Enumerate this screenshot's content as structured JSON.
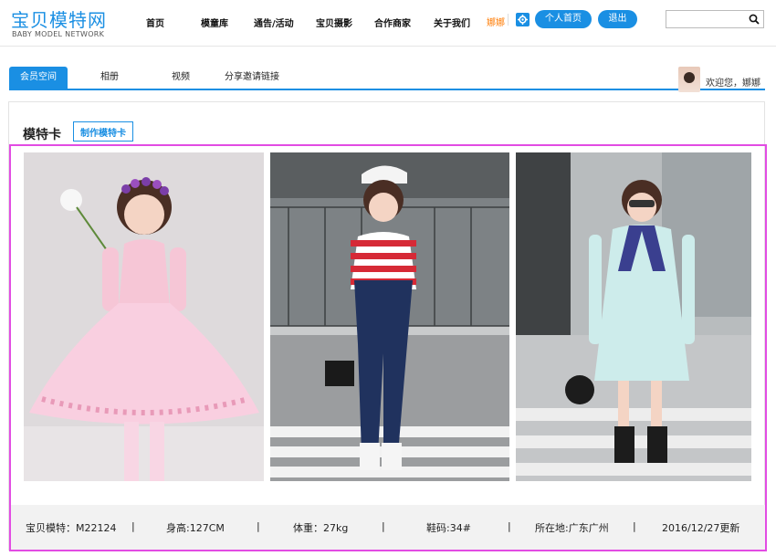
{
  "header": {
    "logo_cn": "宝贝模特网",
    "logo_en": "BABY MODEL NETWORK",
    "nav": [
      "首页",
      "模童库",
      "通告/活动",
      "宝贝摄影",
      "合作商家",
      "关于我们"
    ],
    "username": "娜娜",
    "profile_button": "个人首页",
    "logout_button": "退出",
    "search_placeholder": ""
  },
  "tabs": {
    "items": [
      "会员空间",
      "相册",
      "视频",
      "分享邀请链接"
    ],
    "active": "会员空间"
  },
  "welcome": "欢迎您，娜娜",
  "panel": {
    "title": "模特卡",
    "make_card_button": "制作模特卡"
  },
  "photos": [
    {
      "description_icon": "girl-pink-dress-photo"
    },
    {
      "description_icon": "girl-striped-shirt-photo"
    },
    {
      "description_icon": "girl-light-blue-dress-photo"
    }
  ],
  "info": {
    "model_id": "宝贝模特：M22124",
    "height": "身高:127CM",
    "weight": "体重：27kg",
    "shoe": "鞋码:34#",
    "location": "所在地:广东广州",
    "updated": "2016/12/27更新",
    "separator": "|"
  },
  "colors": {
    "accent": "#1a8fe3",
    "username": "#ff7a00",
    "highlight_border": "#e24ce3"
  }
}
